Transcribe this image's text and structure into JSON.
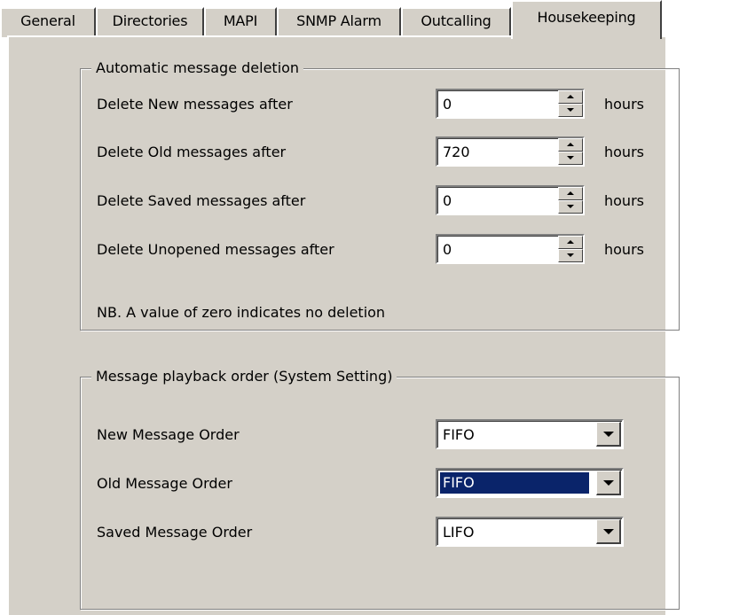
{
  "tabs": [
    {
      "label": "General",
      "active": false
    },
    {
      "label": "Directories",
      "active": false
    },
    {
      "label": "MAPI",
      "active": false
    },
    {
      "label": "SNMP Alarm",
      "active": false
    },
    {
      "label": "Outcalling",
      "active": false
    },
    {
      "label": "Housekeeping",
      "active": true
    }
  ],
  "deletion": {
    "title": "Automatic message deletion",
    "rows": [
      {
        "label": "Delete New messages after",
        "value": "0",
        "unit": "hours"
      },
      {
        "label": "Delete Old messages after",
        "value": "720",
        "unit": "hours"
      },
      {
        "label": "Delete Saved messages after",
        "value": "0",
        "unit": "hours"
      },
      {
        "label": "Delete Unopened messages after",
        "value": "0",
        "unit": "hours"
      }
    ],
    "note": "NB. A value of zero indicates no deletion"
  },
  "playback": {
    "title": "Message playback order (System Setting)",
    "rows": [
      {
        "label": "New Message Order",
        "value": "FIFO"
      },
      {
        "label": "Old Message Order",
        "value": "FIFO"
      },
      {
        "label": "Saved Message Order",
        "value": "LIFO"
      }
    ]
  },
  "colors": {
    "face": "#d4d0c8",
    "highlight": "#0a246a"
  }
}
